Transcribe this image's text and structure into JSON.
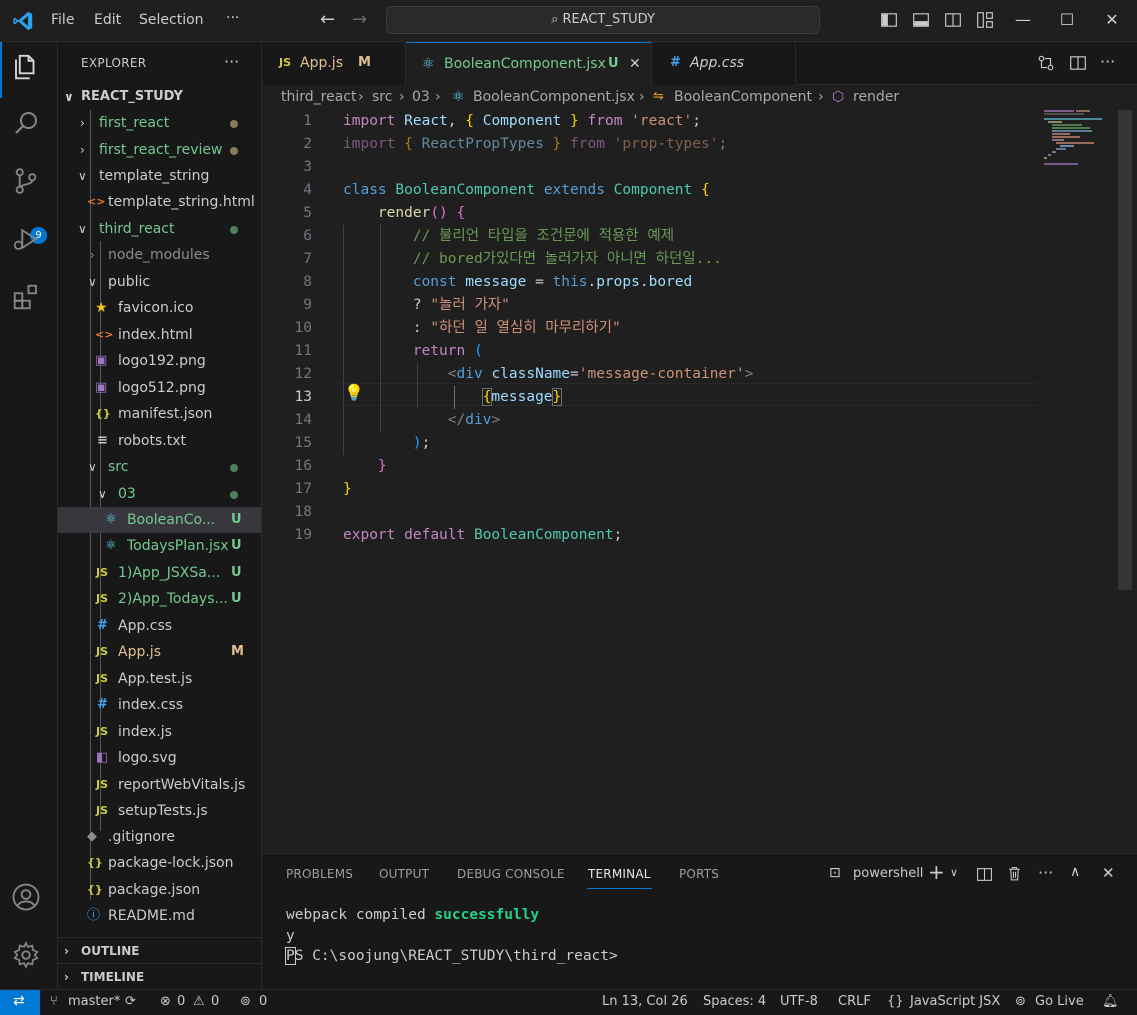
{
  "titlebar": {
    "menu": [
      "File",
      "Edit",
      "Selection",
      "···"
    ],
    "command_center": "REACT_STUDY"
  },
  "activity": {
    "scm_badge": "9"
  },
  "explorer": {
    "title": "EXPLORER",
    "root": "REACT_STUDY",
    "items": [
      {
        "label": "first_react",
        "status": ""
      },
      {
        "label": "first_react_review",
        "status": ""
      },
      {
        "label": "template_string",
        "status": ""
      },
      {
        "label": "template_string.html",
        "status": ""
      },
      {
        "label": "third_react",
        "status": ""
      },
      {
        "label": "node_modules",
        "status": ""
      },
      {
        "label": "public",
        "status": ""
      },
      {
        "label": "favicon.ico",
        "status": ""
      },
      {
        "label": "index.html",
        "status": ""
      },
      {
        "label": "logo192.png",
        "status": ""
      },
      {
        "label": "logo512.png",
        "status": ""
      },
      {
        "label": "manifest.json",
        "status": ""
      },
      {
        "label": "robots.txt",
        "status": ""
      },
      {
        "label": "src",
        "status": ""
      },
      {
        "label": "03",
        "status": ""
      },
      {
        "label": "BooleanCo...",
        "status": "U"
      },
      {
        "label": "TodaysPlan.jsx",
        "status": "U"
      },
      {
        "label": "1)App_JSXSa...",
        "status": "U"
      },
      {
        "label": "2)App_Todays...",
        "status": "U"
      },
      {
        "label": "App.css",
        "status": ""
      },
      {
        "label": "App.js",
        "status": "M"
      },
      {
        "label": "App.test.js",
        "status": ""
      },
      {
        "label": "index.css",
        "status": ""
      },
      {
        "label": "index.js",
        "status": ""
      },
      {
        "label": "logo.svg",
        "status": ""
      },
      {
        "label": "reportWebVitals.js",
        "status": ""
      },
      {
        "label": "setupTests.js",
        "status": ""
      },
      {
        "label": ".gitignore",
        "status": ""
      },
      {
        "label": "package-lock.json",
        "status": ""
      },
      {
        "label": "package.json",
        "status": ""
      },
      {
        "label": "README.md",
        "status": ""
      }
    ],
    "outline": "OUTLINE",
    "timeline": "TIMELINE"
  },
  "tabs": [
    {
      "label": "App.js",
      "status": "M",
      "icon": "JS"
    },
    {
      "label": "BooleanComponent.jsx",
      "status": "U",
      "icon": "react-icon"
    },
    {
      "label": "App.css",
      "status": "",
      "icon": "#"
    }
  ],
  "breadcrumb": [
    "third_react",
    "src",
    "03",
    "BooleanComponent.jsx",
    "BooleanComponent",
    "render"
  ],
  "editor": {
    "line_numbers": [
      "1",
      "2",
      "3",
      "4",
      "5",
      "6",
      "7",
      "8",
      "9",
      "10",
      "11",
      "12",
      "13",
      "14",
      "15",
      "16",
      "17",
      "18",
      "19"
    ],
    "current_line": "13",
    "comment1": "// 불리언 타입을 조건문에 적용한 예제",
    "comment2": "// bored가있다면 놀러가자 아니면 하던일...",
    "str_true": "\"놀러 가자\"",
    "str_false": "\"하던 일 열심히 마무리하기\"",
    "react_str": "'react'",
    "proptypes_str": "'prop-types'",
    "classname_str": "'message-container'"
  },
  "panel": {
    "tabs": [
      "PROBLEMS",
      "OUTPUT",
      "DEBUG CONSOLE",
      "TERMINAL",
      "PORTS"
    ],
    "shell": "powershell",
    "line1_prefix": "webpack compiled ",
    "line1_status": "successfully",
    "line2": "y",
    "prompt": "PS C:\\soojung\\REACT_STUDY\\third_react>"
  },
  "statusbar": {
    "branch": "master*",
    "errors": "0",
    "warnings": "0",
    "ports": "0",
    "position": "Ln 13, Col 26",
    "spaces": "Spaces: 4",
    "encoding": "UTF-8",
    "eol": "CRLF",
    "language": "JavaScript JSX",
    "golive": "Go Live"
  },
  "colors": {
    "accent": "#0078d4",
    "untracked": "#73c991",
    "modified": "#e2c08d"
  }
}
